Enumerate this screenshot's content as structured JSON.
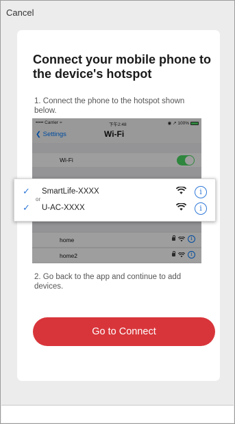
{
  "header": {
    "cancel_label": "Cancel"
  },
  "card": {
    "title": "Connect your mobile phone to the device's hotspot",
    "step1": "1. Connect the phone to the hotspot shown below.",
    "step2": "2. Go back to the app and continue to add devices.",
    "button_label": "Go to Connect"
  },
  "phone": {
    "carrier": "••••• Carrier ≈",
    "time": "下午2:48",
    "battery": "◉ ↗ 100%",
    "back_label": "Settings",
    "nav_title": "Wi-Fi",
    "wifi_label": "Wi-Fi",
    "wifi_on": true,
    "networks": [
      {
        "name": "home",
        "locked": true
      },
      {
        "name": "home2",
        "locked": true
      }
    ]
  },
  "popup": {
    "networks": [
      {
        "name": "SmartLife-XXXX",
        "checked": true
      },
      {
        "name": "U-AC-XXXX",
        "checked": true
      }
    ],
    "or_label": "or"
  },
  "colors": {
    "accent": "#d8353a",
    "check_blue": "#2f78d8",
    "ios_blue": "#007aff",
    "toggle_green": "#4cd964"
  }
}
